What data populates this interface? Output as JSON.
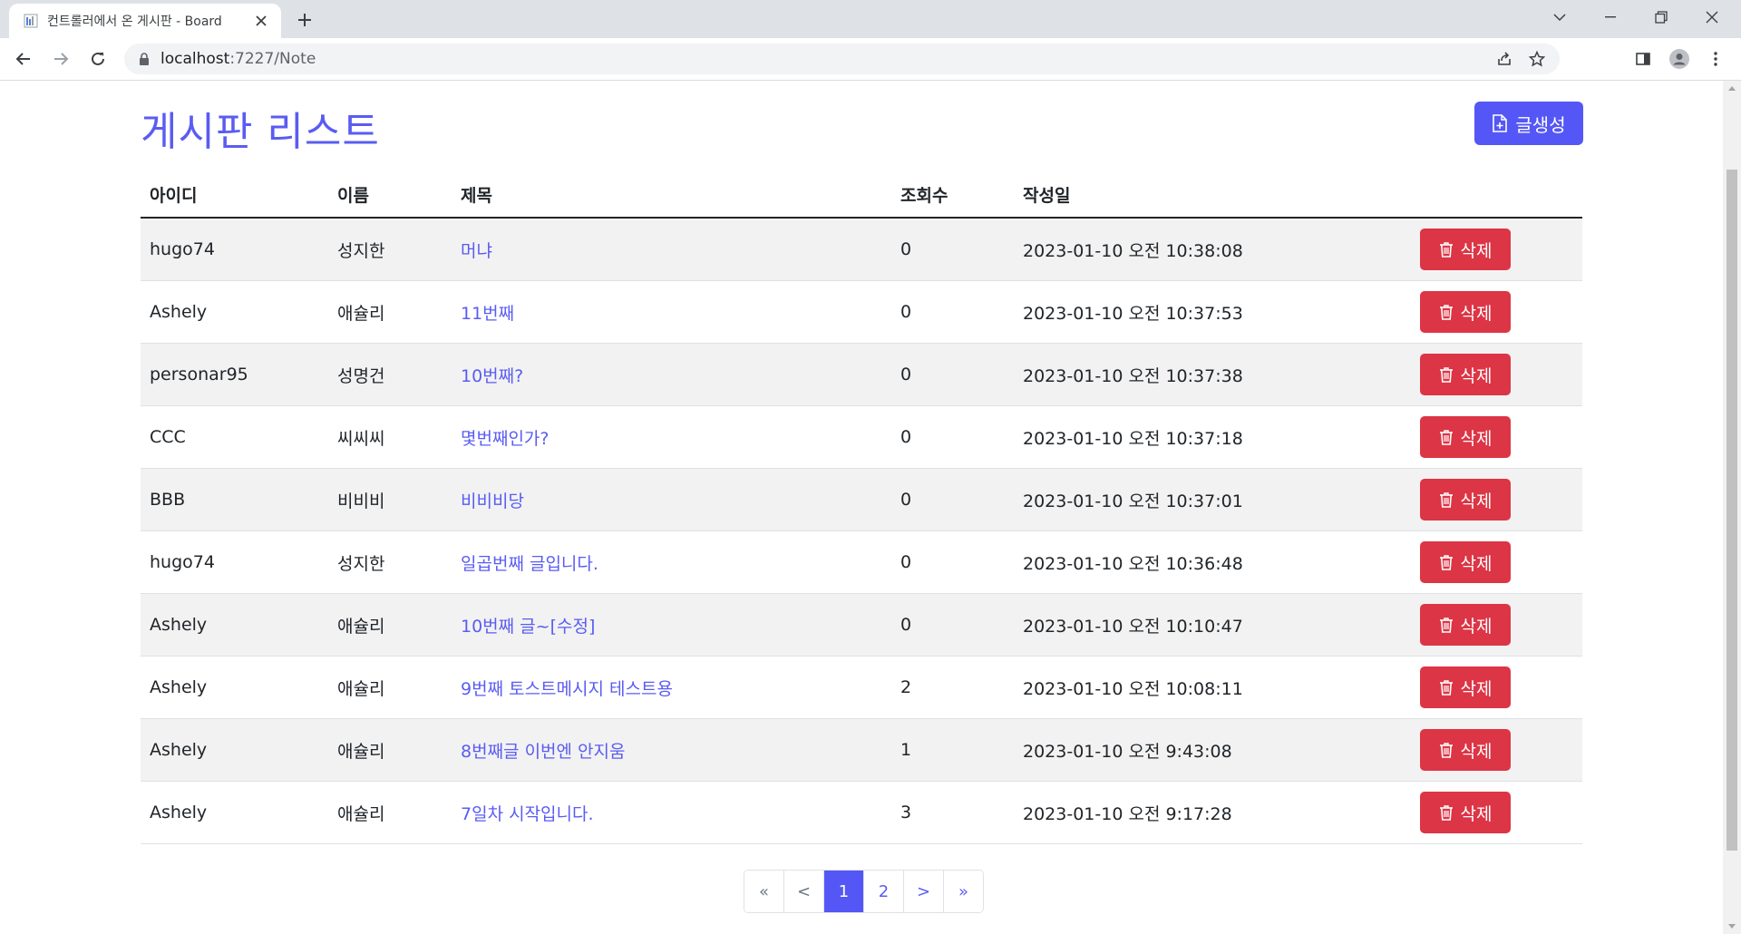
{
  "browser": {
    "tab_title": "컨트롤러에서 온 게시판 - Board",
    "url_host": "localhost",
    "url_path": ":7227/Note"
  },
  "page": {
    "title": "게시판 리스트",
    "create_label": "글생성"
  },
  "table": {
    "headers": {
      "id": "아이디",
      "name": "이름",
      "subject": "제목",
      "views": "조회수",
      "date": "작성일"
    },
    "delete_label": "삭제",
    "rows": [
      {
        "id": "hugo74",
        "name": "성지한",
        "subject": "머냐",
        "views": "0",
        "date": "2023-01-10 오전 10:38:08"
      },
      {
        "id": "Ashely",
        "name": "애슐리",
        "subject": "11번째",
        "views": "0",
        "date": "2023-01-10 오전 10:37:53"
      },
      {
        "id": "personar95",
        "name": "성명건",
        "subject": "10번째?",
        "views": "0",
        "date": "2023-01-10 오전 10:37:38"
      },
      {
        "id": "CCC",
        "name": "씨씨씨",
        "subject": "몇번째인가?",
        "views": "0",
        "date": "2023-01-10 오전 10:37:18"
      },
      {
        "id": "BBB",
        "name": "비비비",
        "subject": "비비비당",
        "views": "0",
        "date": "2023-01-10 오전 10:37:01"
      },
      {
        "id": "hugo74",
        "name": "성지한",
        "subject": "일곱번째 글입니다.",
        "views": "0",
        "date": "2023-01-10 오전 10:36:48"
      },
      {
        "id": "Ashely",
        "name": "애슐리",
        "subject": "10번째 글~[수정]",
        "views": "0",
        "date": "2023-01-10 오전 10:10:47"
      },
      {
        "id": "Ashely",
        "name": "애슐리",
        "subject": "9번째 토스트메시지 테스트용",
        "views": "2",
        "date": "2023-01-10 오전 10:08:11"
      },
      {
        "id": "Ashely",
        "name": "애슐리",
        "subject": "8번째글 이번엔 안지움",
        "views": "1",
        "date": "2023-01-10 오전 9:43:08"
      },
      {
        "id": "Ashely",
        "name": "애슐리",
        "subject": "7일차 시작입니다.",
        "views": "3",
        "date": "2023-01-10 오전 9:17:28"
      }
    ]
  },
  "pagination": {
    "first": "«",
    "prev": "<",
    "pages": [
      "1",
      "2"
    ],
    "current": "1",
    "next": ">",
    "last": "»"
  },
  "colors": {
    "primary": "#5457f6",
    "link": "#5a5cf2",
    "danger": "#dc3545",
    "stripe": "#f2f2f2"
  }
}
